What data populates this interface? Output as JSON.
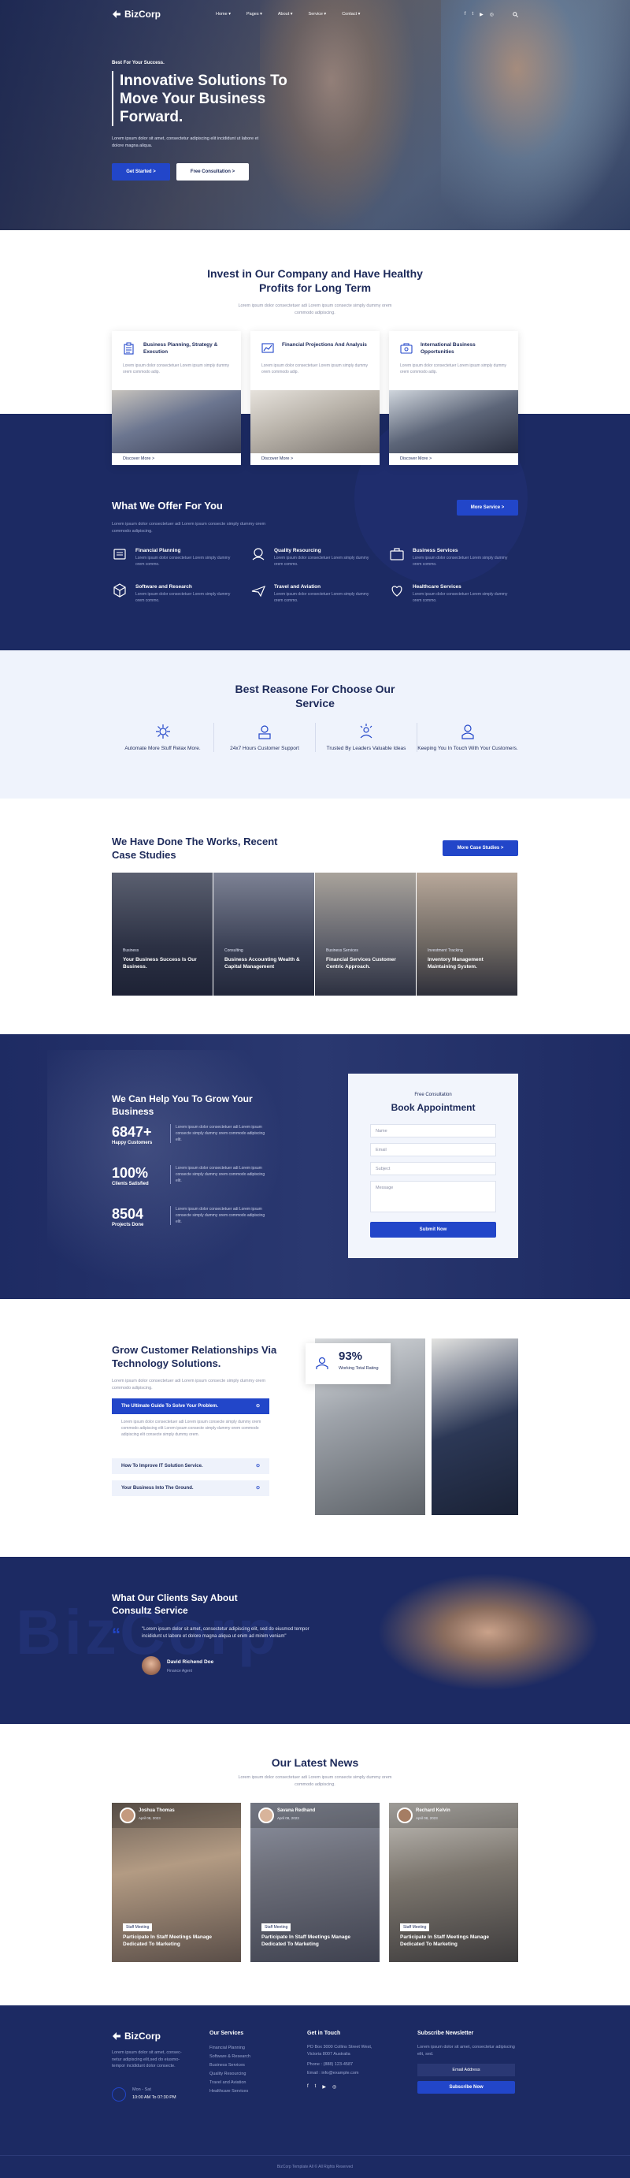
{
  "nav": {
    "logo": "BizCorp",
    "links": [
      "Home",
      "Pages",
      "About",
      "Service",
      "Contact"
    ],
    "social": [
      "f",
      "t",
      "▶",
      "◎"
    ]
  },
  "hero": {
    "kicker": "Best For Your Success.",
    "title": "Innovative Solutions To Move Your Business Forward.",
    "text": "Lorem ipsum dolor sit amet, consectetur adipiscing elit incididunt ut labore et dolore magna aliqua.",
    "btn_primary": "Get Started >",
    "btn_secondary": "Free Consultation >"
  },
  "invest": {
    "title": "Invest in Our Company and Have Healthy Profits for Long Term",
    "text": "Lorem ipsum dolor consectetuer adi Lorem ipsum consecte simply dummy orem commodo adipiscing.",
    "cards": [
      {
        "title": "Business Planning, Strategy & Execution",
        "text": "Lorem ipsum dolor consectetuer Lorem ipsum simply dummy orem commodo adip.",
        "link": "Discover More >"
      },
      {
        "title": "Financial Projections And Analysis",
        "text": "Lorem ipsum dolor consectetuer Lorem ipsum simply dummy orem commodo adip.",
        "link": "Discover More >"
      },
      {
        "title": "International Business Opportunities",
        "text": "Lorem ipsum dolor consectetuer Lorem ipsum simply dummy orem commodo adip.",
        "link": "Discover More >"
      }
    ]
  },
  "offer": {
    "title": "What We Offer For You",
    "text": "Lorem ipsum dolor consectetuer adi Lorem ipsum consecte simply dummy orem commodo adipiscing.",
    "btn": "More Service >",
    "items": [
      {
        "title": "Financial Planning",
        "text": "Lorem ipsum dolor consectetuer Lorem simply dummy orem commo."
      },
      {
        "title": "Quality Resourcing",
        "text": "Lorem ipsum dolor consectetuer Lorem simply dummy orem commo."
      },
      {
        "title": "Business Services",
        "text": "Lorem ipsum dolor consectetuer Lorem simply dummy orem commo."
      },
      {
        "title": "Software and Research",
        "text": "Lorem ipsum dolor consectetuer Lorem simply dummy orem commo."
      },
      {
        "title": "Travel and Aviation",
        "text": "Lorem ipsum dolor consectetuer Lorem simply dummy orem commo."
      },
      {
        "title": "Healthcare Services",
        "text": "Lorem ipsum dolor consectetuer Lorem simply dummy orem commo."
      }
    ]
  },
  "reasons": {
    "title": "Best Reasone For Choose Our Service",
    "items": [
      "Automate More Stuff Relax More.",
      "24x7 Hours Customer Support",
      "Trusted By Leaders Valuable Ideas",
      "Keeping You In Touch With Your Customers."
    ]
  },
  "cases": {
    "title": "We Have Done The Works, Recent Case Studies",
    "btn": "More Case Studies >",
    "items": [
      {
        "label": "Business",
        "title": "Your Business Success Is Our Business."
      },
      {
        "label": "Consulting",
        "title": "Business Accounting Wealth & Capital Management"
      },
      {
        "label": "Business Services",
        "title": "Financial Services Customer Centric Approach."
      },
      {
        "label": "Investment Tracking",
        "title": "Inventory Management Maintaining System."
      }
    ]
  },
  "grow": {
    "title": "We Can Help You To Grow Your Business",
    "stats": [
      {
        "num": "6847+",
        "label": "Happy Customers",
        "text": "Lorem ipsum dolor consectetuer adi Lorem ipsum consecte simply dummy orem commodo adipiscing elit."
      },
      {
        "num": "100%",
        "label": "Clients Satisfied",
        "text": "Lorem ipsum dolor consectetuer adi Lorem ipsum consecte simply dummy orem commodo adipiscing elit."
      },
      {
        "num": "8504",
        "label": "Projects Done",
        "text": "Lorem ipsum dolor consectetuer adi Lorem ipsum consecte simply dummy orem commodo adipiscing elit."
      }
    ],
    "form": {
      "kicker": "Free Consultation",
      "title": "Book Appointment",
      "name": "Name",
      "email": "Email",
      "subject": "Subject",
      "message": "Message",
      "submit": "Submit Now"
    }
  },
  "tech": {
    "title": "Grow Customer Relationships Via Technology Solutions.",
    "text": "Lorem ipsum dolor consectetuer adi Lorem ipsum consecte simply dummy orem commodo adipiscing.",
    "acc": [
      {
        "q": "The Ultimate Guide To Solve Your Problem.",
        "a": "Lorem ipsum dolor consectetuer adi Lorem ipsum consecte simply dummy orem commodo adipiscing elit Lorem ipsum consecte simply dummy orem commodo adipiscing elit consecte simply dummy orem."
      },
      {
        "q": "How To Improve IT Solution Service."
      },
      {
        "q": "Your Business Into The Ground."
      }
    ],
    "badge_num": "93%",
    "badge_text": "Working Total Rating"
  },
  "testimonial": {
    "title": "What Our Clients Say About Consultz Service",
    "quote": "\"Lorem ipsum dolor sit amet, consectetur adipiscing elit, sed do eiusmod tempor incididunt ut labore et dolore magna aliqua ut enim ad minim veniam\"",
    "name": "David Richend Doe",
    "role": "Finance Agent",
    "watermark": "BizCorp"
  },
  "news": {
    "title": "Our Latest News",
    "text": "Lorem ipsum dolor consectetuer adi Lorem ipsum consecte simply dummy orem commodo adipiscing.",
    "items": [
      {
        "author": "Joshua Thomas",
        "date": "April 08, 2023",
        "tag": "Staff Meeting",
        "title": "Participate In Staff Meetings Manage Dedicated To Marketing"
      },
      {
        "author": "Savana Redhand",
        "date": "April 08, 2023",
        "tag": "Staff Meeting",
        "title": "Participate In Staff Meetings Manage Dedicated To Marketing"
      },
      {
        "author": "Rechard Kelvin",
        "date": "April 08, 2023",
        "tag": "Staff Meeting",
        "title": "Participate In Staff Meetings Manage Dedicated To Marketing"
      }
    ]
  },
  "footer": {
    "logo": "BizCorp",
    "about": "Lorem ipsum dolor sit amet, consec-netur adipiscing elit,sed do eiusmo-tempor incididunt dolor consecte.",
    "hours_label": "Mon - Sat",
    "hours": "10:00 AM To 07:30 PM",
    "services_title": "Our Services",
    "services": [
      "Financial Planning",
      "Software & Research",
      "Business Services",
      "Quality Resourcing",
      "Travel and Aviation",
      "Healthcare Services"
    ],
    "contact_title": "Get in Touch",
    "address": "PO Box 3000 Collins Street West, Victoria 8007 Australia",
    "phone": "Phone : (888) 123-4587",
    "email": "Email :  info@example.com",
    "newsletter_title": "Subscribe Newsletter",
    "newsletter_text": "Lorem ipsum dolor sit amet, consectetur adipiscing elit, sed.",
    "newsletter_placeholder": "Email Address",
    "newsletter_btn": "Subscribe Now",
    "copyright": "BizCorp Template All © All Rights Reserved"
  }
}
